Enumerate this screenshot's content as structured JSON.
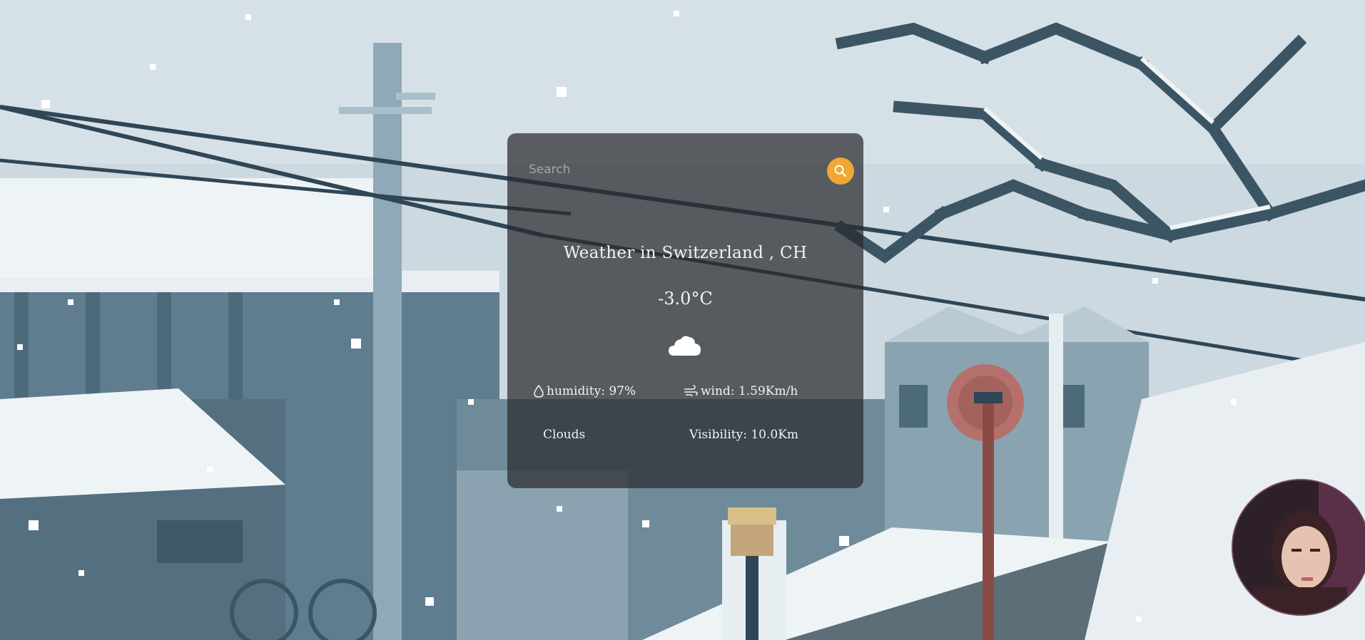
{
  "search": {
    "placeholder": "Search"
  },
  "weather": {
    "title": "Weather in Switzerland , CH",
    "temperature": "-3.0°C",
    "condition_icon": "cloud-icon",
    "humidity": "humidity: 97%",
    "wind": "wind: 1.59Km/h",
    "description": "Clouds",
    "visibility": "Visibility: 10.0Km"
  },
  "colors": {
    "accent": "#f0a733",
    "card_bg": "rgba(40,42,46,0.72)",
    "text": "#f2f2f2"
  }
}
